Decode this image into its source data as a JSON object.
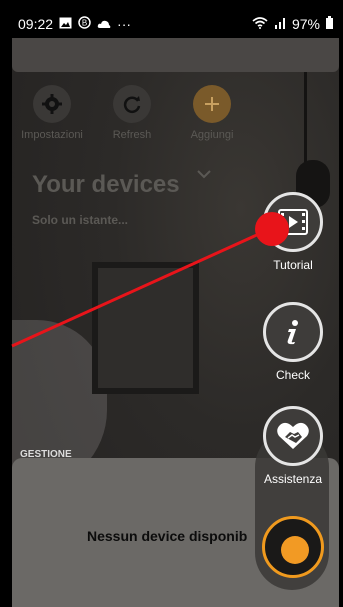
{
  "status_bar": {
    "time": "09:22",
    "battery_percent": "97%",
    "more": "···"
  },
  "toolbar": {
    "settings_label": "Impostazioni",
    "refresh_label": "Refresh",
    "add_label": "Aggiungi"
  },
  "header": {
    "title": "Your devices",
    "subtitle": "Solo un istante..."
  },
  "section": {
    "gestione": "GESTIONE"
  },
  "empty_state": {
    "text": "Nessun device disponib"
  },
  "fab_menu": {
    "tutorial": "Tutorial",
    "check": "Check",
    "assistenza": "Assistenza"
  },
  "colors": {
    "accent": "#f29a24",
    "marker": "#e8141a"
  },
  "icons": [
    "gear-icon",
    "refresh-icon",
    "plus-icon",
    "video-icon",
    "info-icon",
    "handshake-icon"
  ]
}
